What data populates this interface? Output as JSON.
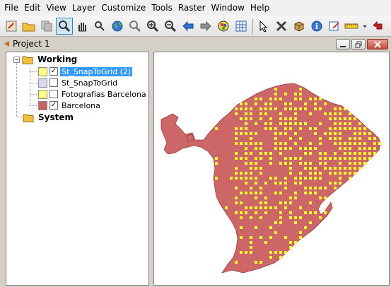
{
  "menu": [
    "File",
    "Edit",
    "View",
    "Layer",
    "Customize",
    "Tools",
    "Raster",
    "Window",
    "Help"
  ],
  "toolbar": {
    "icons": [
      "selection-tool-icon",
      "open-folder-icon",
      "copy-icon",
      "zoom-select-icon",
      "pan-hand-icon",
      "zoom-hand-icon",
      "globe-icon",
      "zoom-out-icon",
      "zoom-in-icon",
      "zoom-minus-icon",
      "back-arrow-icon",
      "forward-arrow-icon",
      "layer-color-icon",
      "table-icon",
      "pointer-icon",
      "delete-tool-icon",
      "package-icon",
      "info-icon",
      "edit-icon",
      "ruler-icon",
      "undo-icon"
    ]
  },
  "project": {
    "title": "Project 1"
  },
  "tree": {
    "working": "Working",
    "system": "System",
    "layers": [
      {
        "label": "St_SnapToGrid (2)",
        "checked": true,
        "swatch": "#ffff80",
        "selected": true
      },
      {
        "label": "St_SnapToGrid",
        "checked": false,
        "swatch": "#d8d8f0",
        "selected": false
      },
      {
        "label": "Fotografías Barcelona",
        "checked": false,
        "swatch": "#ffff80",
        "selected": false
      },
      {
        "label": "Barcelona",
        "checked": true,
        "swatch": "#c86060",
        "selected": false
      }
    ]
  },
  "map": {
    "fill": "#cd6767",
    "point_color": "#ffff33"
  }
}
